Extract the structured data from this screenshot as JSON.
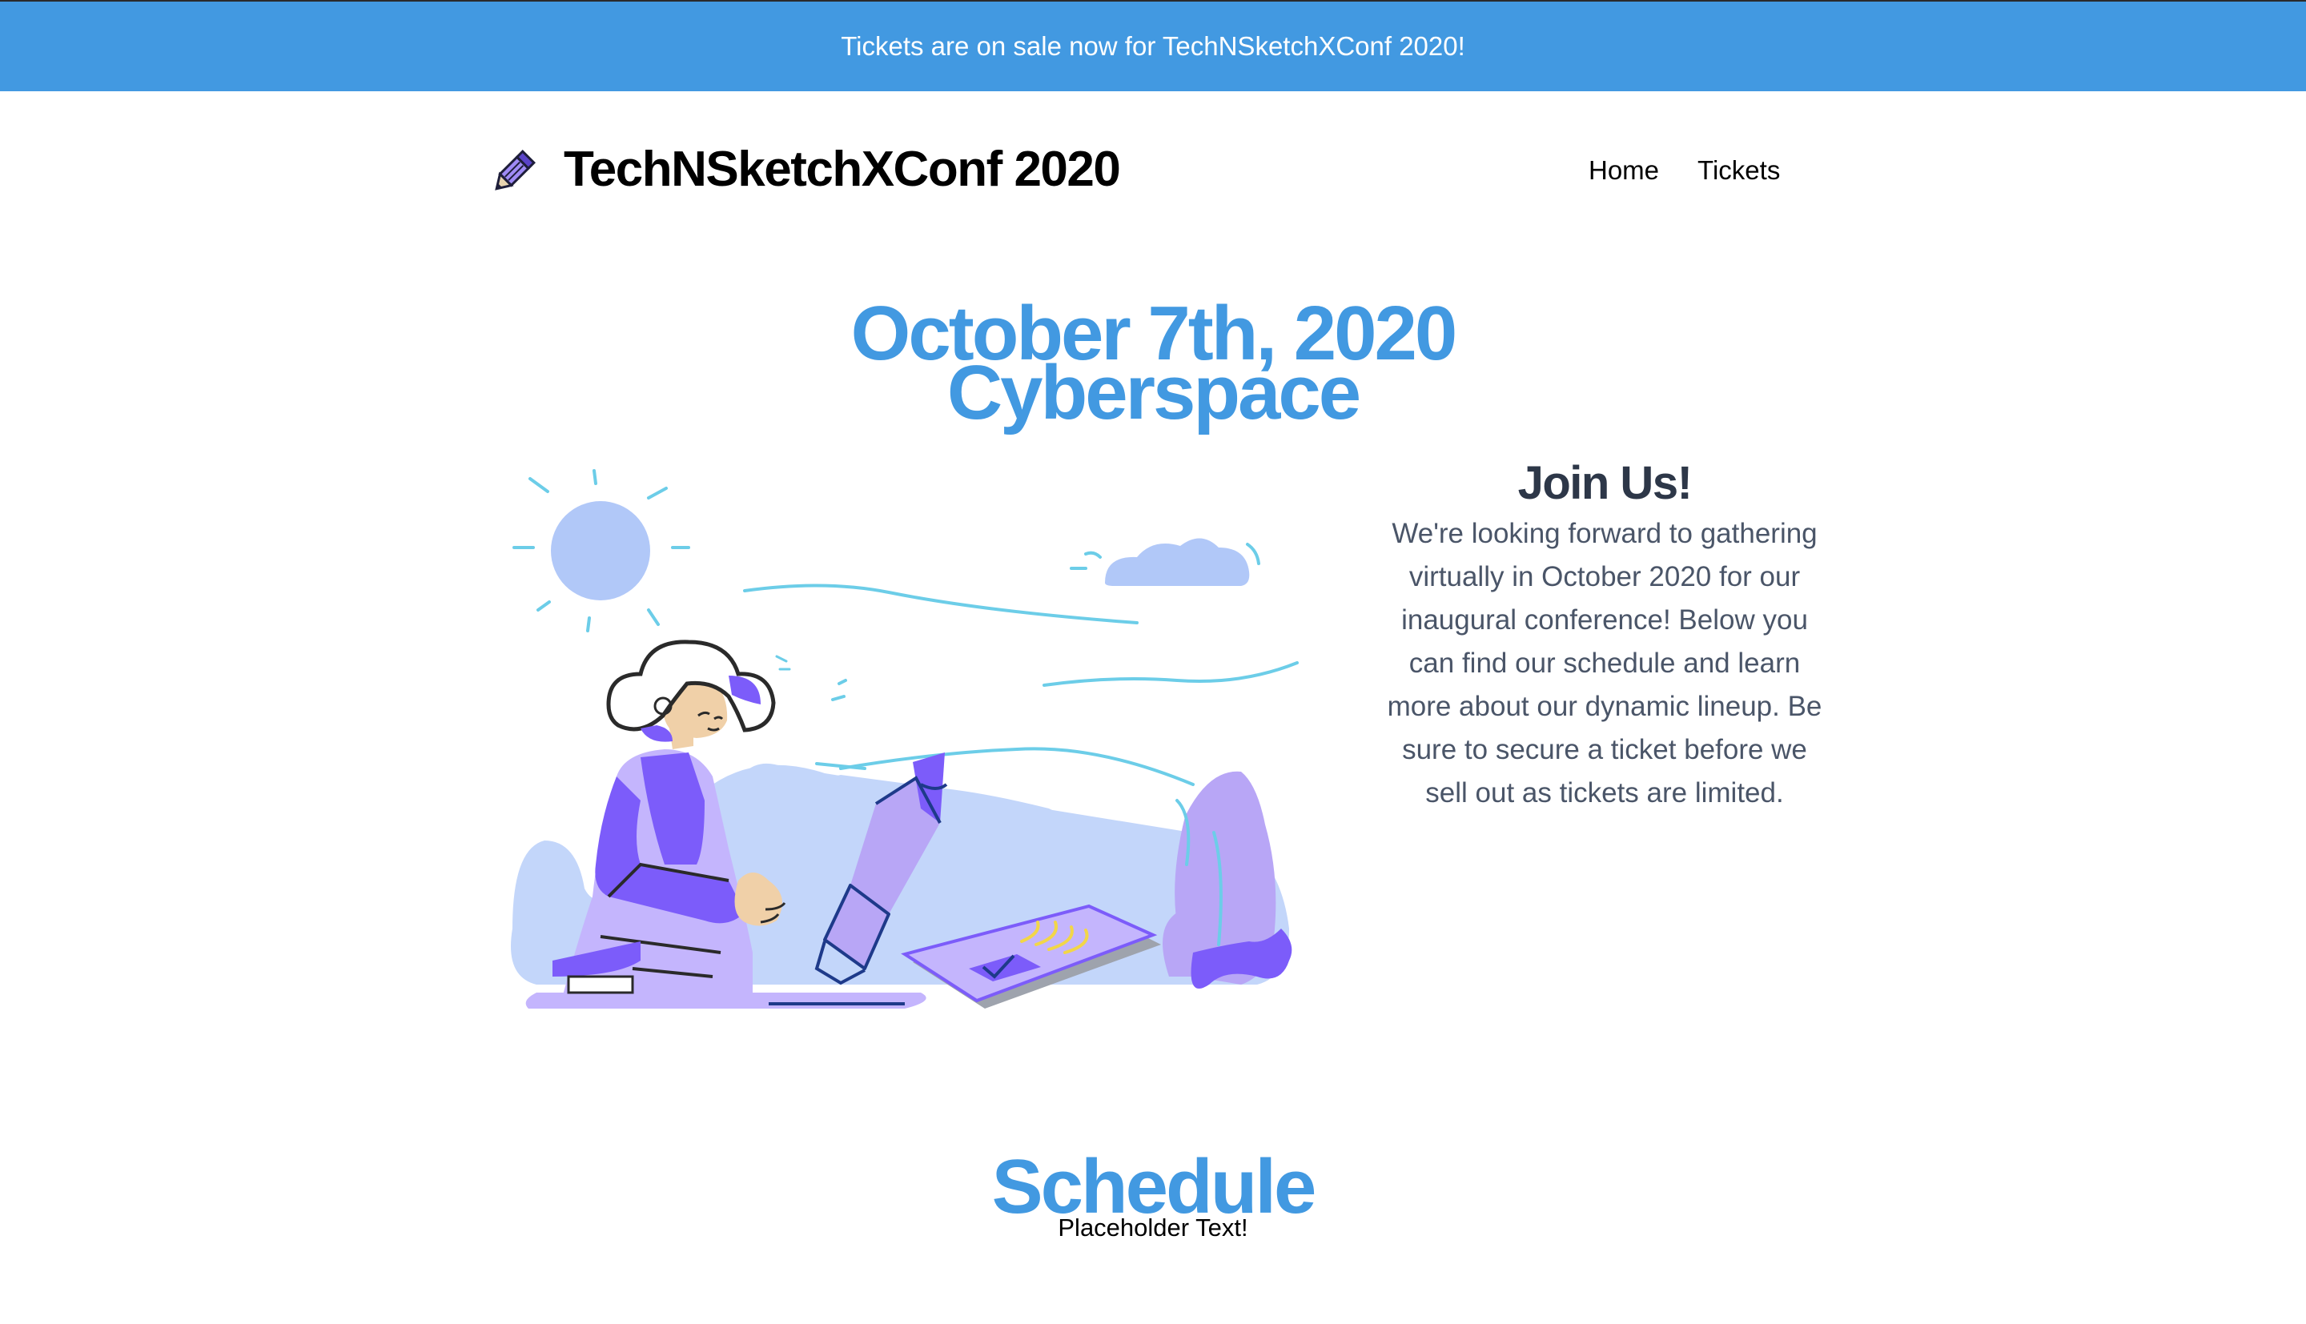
{
  "banner": {
    "text": "Tickets are on sale now for TechNSketchXConf 2020!"
  },
  "header": {
    "logo_icon": "pencil-icon",
    "title": "TechNSketchXConf 2020",
    "nav": [
      {
        "label": "Home"
      },
      {
        "label": "Tickets"
      }
    ]
  },
  "hero": {
    "date": "October 7th, 2020",
    "location": "Cyberspace",
    "illustration": "person-drawing-with-giant-pencil-illustration"
  },
  "join": {
    "title": "Join Us!",
    "body": "We're looking forward to gathering virtually in October 2020 for our inaugural conference! Below you can find our schedule and learn more about our dynamic lineup. Be sure to secure a ticket before we sell out as tickets are limited."
  },
  "schedule": {
    "title": "Schedule",
    "subtitle": "Placeholder Text!"
  },
  "colors": {
    "accent": "#4299e1",
    "heading_dark": "#2d3748",
    "body_text": "#4a5568",
    "purple": "#7c5cfa",
    "light_purple": "#c4b5fd",
    "light_blue": "#c3d6fa"
  }
}
